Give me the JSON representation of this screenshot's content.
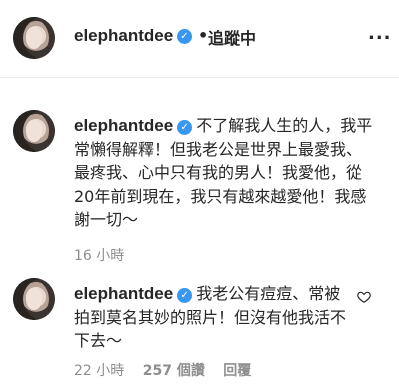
{
  "header": {
    "username": "elephantdee",
    "verified_icon": "verified-badge-icon",
    "separator": "•",
    "follow_status": "追蹤中",
    "more_icon": "more-options-icon",
    "more_label": "..."
  },
  "comments": [
    {
      "username": "elephantdee",
      "text": "不了解我人生的人，我平常懶得解釋！但我老公是世界上最愛我、最疼我、心中只有我的男人！我愛他，從20年前到現在，我只有越來越愛他！我感謝一切～",
      "time": "16 小時"
    },
    {
      "username": "elephantdee",
      "text": "我老公有痘痘、常被拍到莫名其妙的照片！但沒有他我活不下去～",
      "time": "22 小時",
      "likes": "257 個讚",
      "reply": "回覆"
    }
  ],
  "colors": {
    "text": "#262626",
    "meta": "#8e8e8e",
    "verified": "#3897f0",
    "divider": "#efefef"
  }
}
